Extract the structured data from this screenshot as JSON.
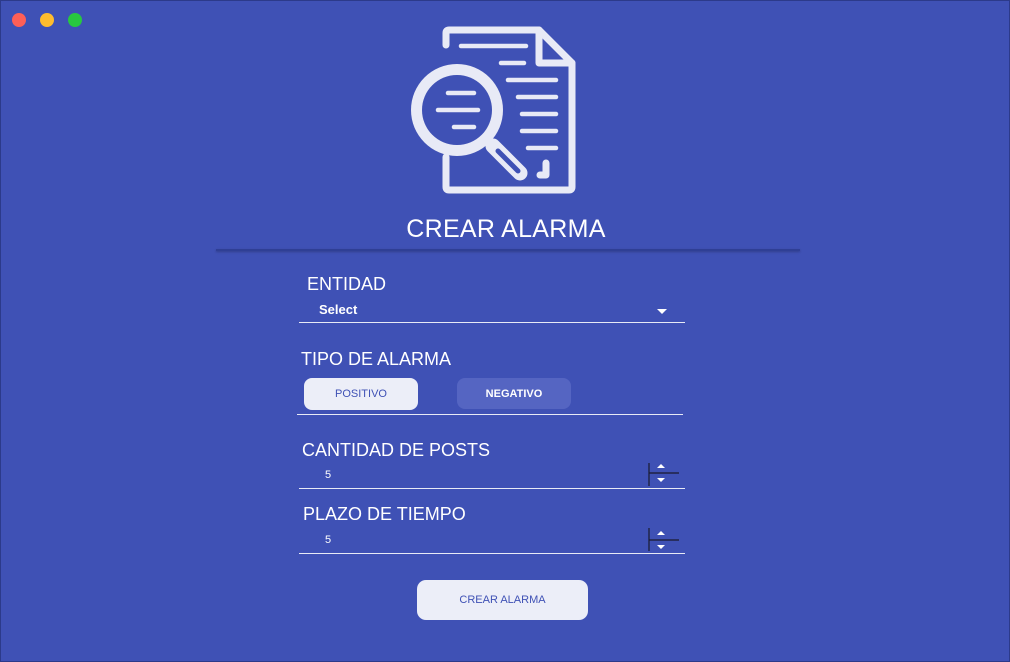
{
  "title": "CREAR ALARMA",
  "logo_icon": "document-search-icon",
  "form": {
    "entidad": {
      "label": "ENTIDAD",
      "value": "Select"
    },
    "tipo": {
      "label": "TIPO DE ALARMA",
      "options": [
        "POSITIVO",
        "NEGATIVO"
      ],
      "selected": "POSITIVO"
    },
    "cantidad": {
      "label": "CANTIDAD DE POSTS",
      "value": "5"
    },
    "plazo": {
      "label": "PLAZO DE TIEMPO",
      "value": "5"
    }
  },
  "submit_label": "CREAR ALARMA",
  "colors": {
    "background": "#3f51b5",
    "button": "#eceef8",
    "inactive_button": "#5565c2"
  }
}
